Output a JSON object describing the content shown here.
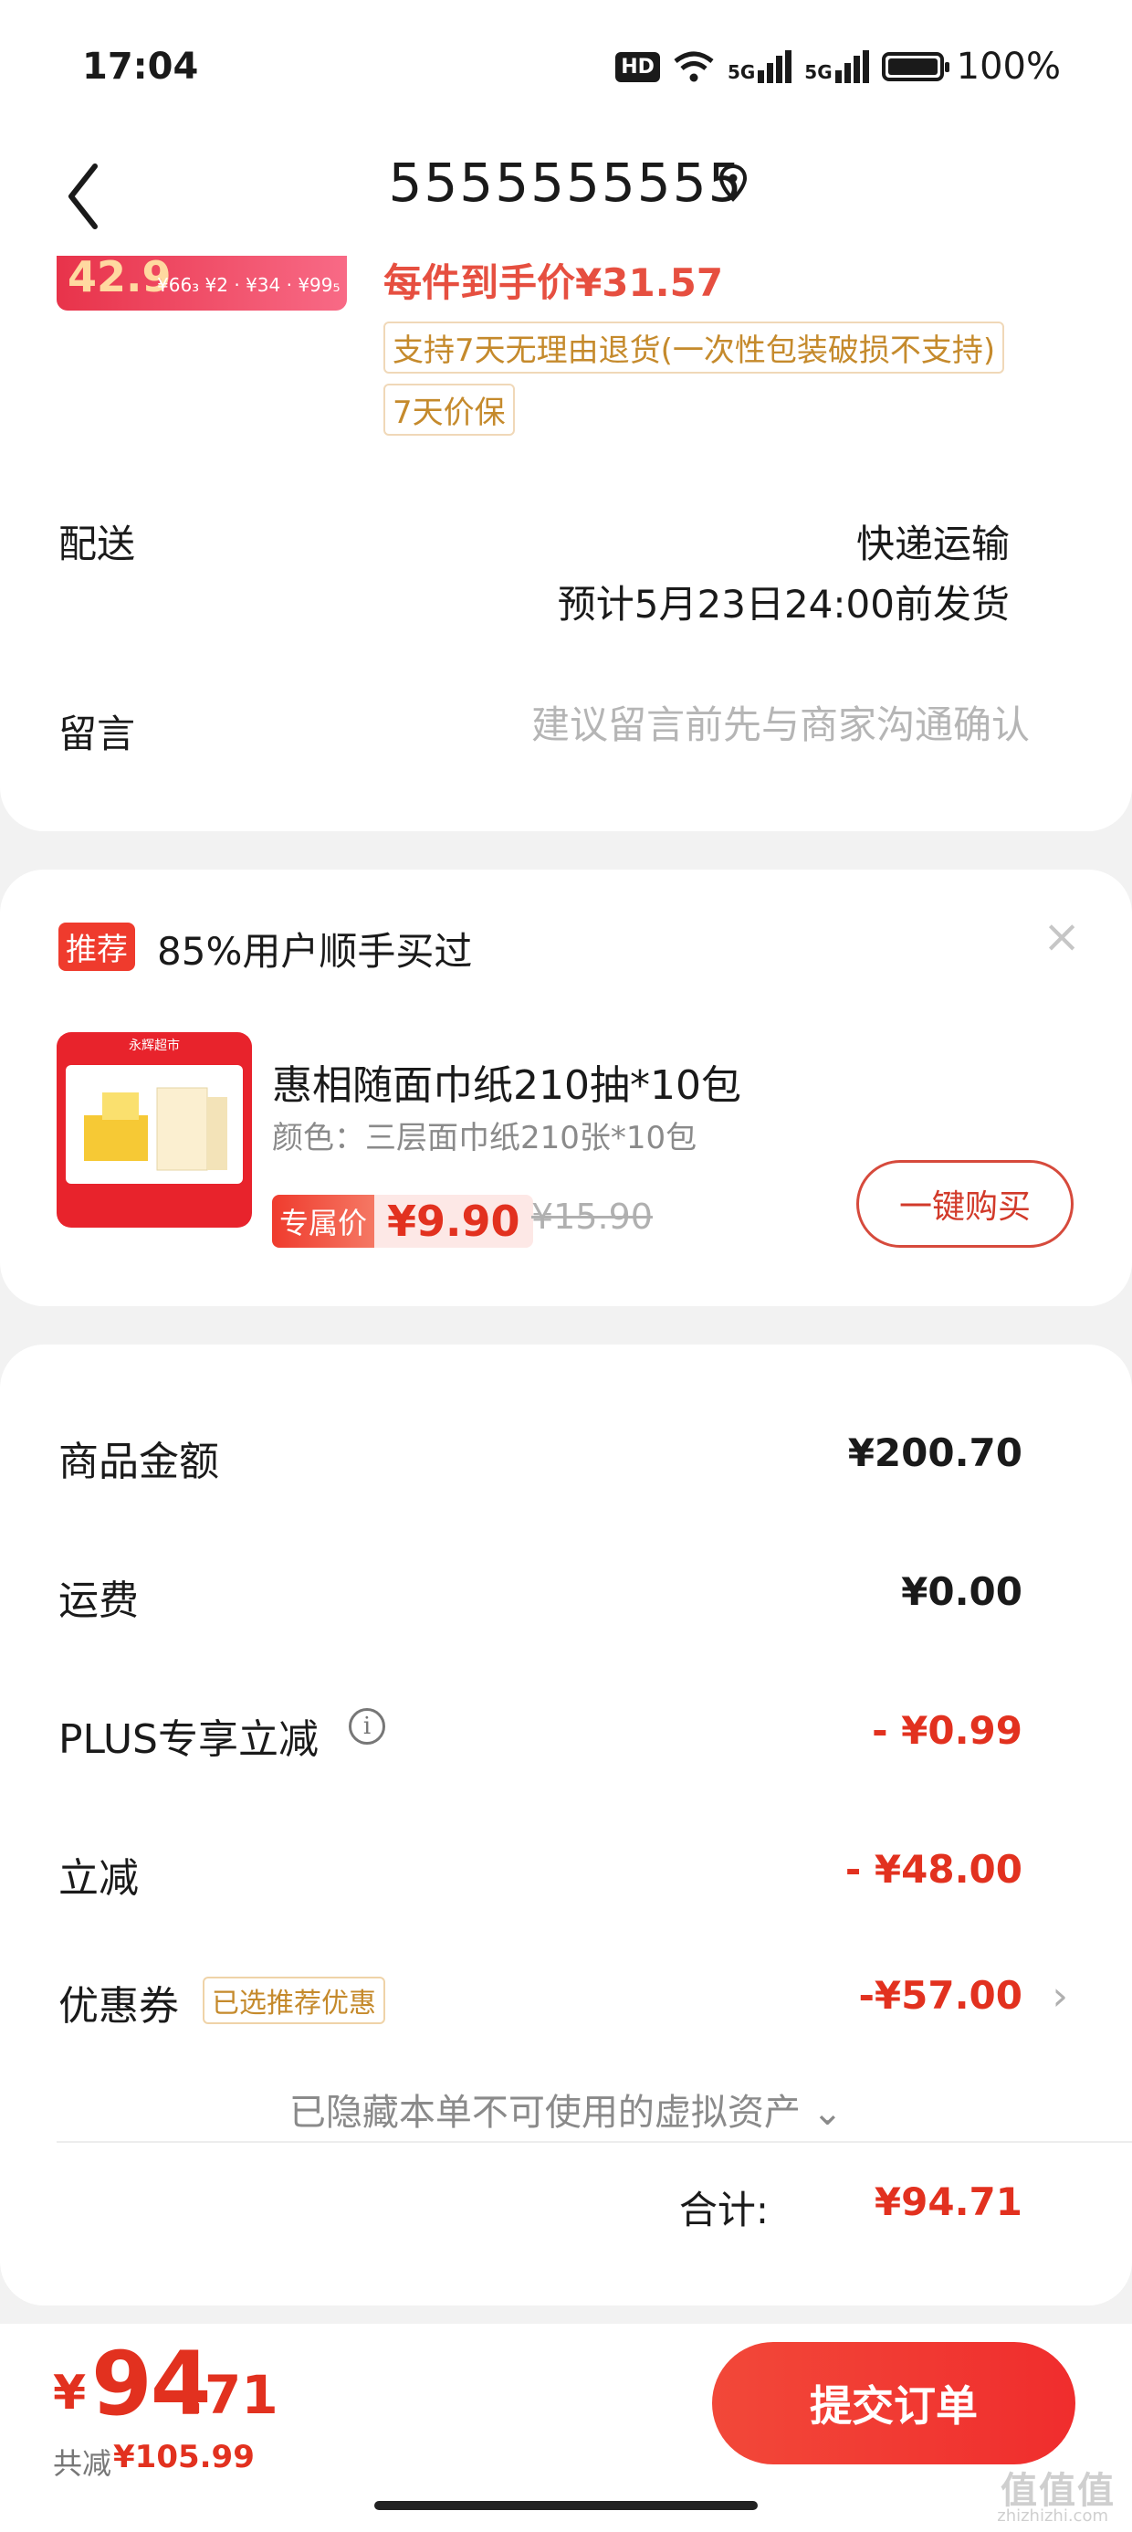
{
  "status_bar": {
    "time": "17:04",
    "hd_badge": "HD",
    "signal_1": "5G",
    "signal_2": "5G",
    "battery_level": 1.0,
    "battery_text": "100%"
  },
  "header": {
    "title": "5555555555",
    "back_icon": "chevron-left-icon",
    "location_icon": "location-pin-icon"
  },
  "product": {
    "thumb_price": "42.9",
    "thumb_tiers": "¥66₃ ¥2 · ¥34 · ¥99₅",
    "unit_price": "每件到手价¥31.57",
    "tags": [
      "支持7天无理由退货(一次性包装破损不支持)",
      "7天价保"
    ]
  },
  "delivery": {
    "label": "配送",
    "method": "快递运输",
    "eta": "预计5月23日24:00前发货"
  },
  "message": {
    "label": "留言",
    "placeholder": "建议留言前先与商家沟通确认"
  },
  "recommendation": {
    "badge": "推荐",
    "title": "85%用户顺手买过",
    "close_icon": "close-icon",
    "image_brand": "永辉超市",
    "product_name": "惠相随面巾纸210抽*10包",
    "spec": "颜色：三层面巾纸210张*10包",
    "exclusive_label": "专属价",
    "price": "¥9.90",
    "original_price": "¥15.90",
    "buy_button": "一键购买"
  },
  "summary": {
    "goods_label": "商品金额",
    "goods_value": "¥200.70",
    "shipping_label": "运费",
    "shipping_value": "¥0.00",
    "plus_label": "PLUS专享立减",
    "plus_value": "- ¥0.99",
    "discount_label": "立减",
    "discount_value": "- ¥48.00",
    "coupon_label": "优惠券",
    "coupon_tag": "已选推荐优惠",
    "coupon_value": "-¥57.00",
    "hidden_assets": "已隐藏本单不可使用的虚拟资产 ⌄",
    "total_label": "合计:",
    "total_value": "¥94.71"
  },
  "footer": {
    "currency": "¥",
    "amount_int": "94",
    "amount_dec": ".71",
    "saved_label": "共减",
    "saved_value": "¥105.99",
    "submit_label": "提交订单",
    "watermark": "值值值",
    "watermark_sub": "zhizhizhi.com"
  },
  "colors": {
    "accent_red": "#e2311f",
    "tag_gold": "#c58a2c",
    "background": "#f2f2f2"
  }
}
